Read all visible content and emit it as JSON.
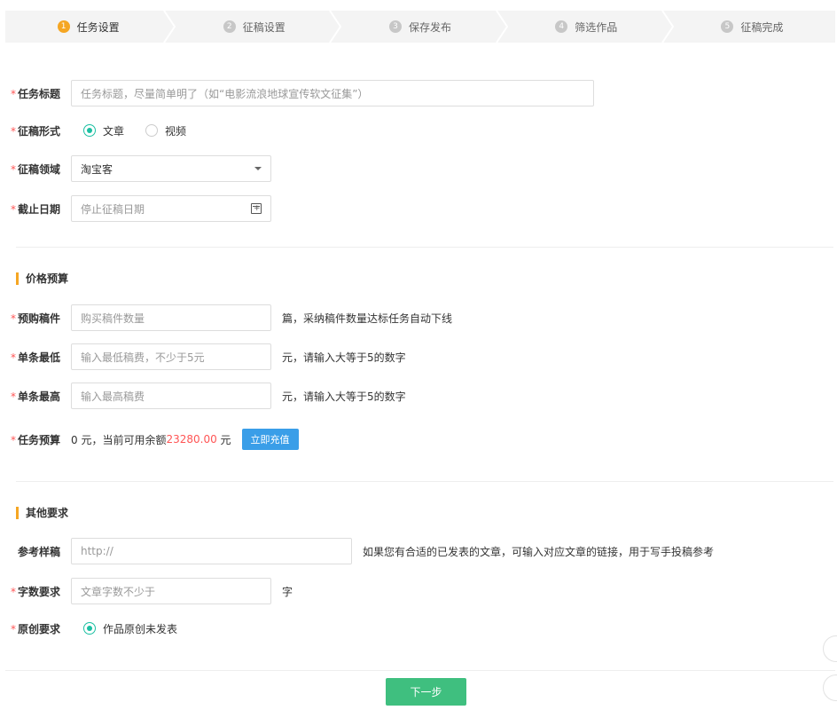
{
  "steps": [
    {
      "num": "1",
      "label": "任务设置"
    },
    {
      "num": "2",
      "label": "征稿设置"
    },
    {
      "num": "3",
      "label": "保存发布"
    },
    {
      "num": "4",
      "label": "筛选作品"
    },
    {
      "num": "5",
      "label": "征稿完成"
    }
  ],
  "form": {
    "task_title": {
      "label": "任务标题",
      "placeholder": "任务标题，尽量简单明了（如“电影流浪地球宣传软文征集”）"
    },
    "format": {
      "label": "征稿形式",
      "options": [
        "文章",
        "视频"
      ],
      "selected": "文章"
    },
    "domain": {
      "label": "征稿领域",
      "value": "淘宝客"
    },
    "deadline": {
      "label": "截止日期",
      "placeholder": "停止征稿日期"
    }
  },
  "budget": {
    "section_title": "价格预算",
    "purchase": {
      "label": "预购稿件",
      "placeholder": "购买稿件数量",
      "suffix": "篇，采纳稿件数量达标任务自动下线"
    },
    "min_price": {
      "label": "单条最低",
      "placeholder": "输入最低稿费，不少于5元",
      "suffix": "元，请输入大等于5的数字"
    },
    "max_price": {
      "label": "单条最高",
      "placeholder": "输入最高稿费",
      "suffix": "元，请输入大等于5的数字"
    },
    "total": {
      "label": "任务预算",
      "text_prefix": "0 元，当前可用余额 ",
      "balance": "23280.00",
      "text_suffix": " 元",
      "recharge_label": "立即充值"
    }
  },
  "other": {
    "section_title": "其他要求",
    "reference": {
      "label": "参考样稿",
      "placeholder": "http://",
      "suffix": "如果您有合适的已发表的文章，可输入对应文章的链接，用于写手投稿参考"
    },
    "word_count": {
      "label": "字数要求",
      "placeholder": "文章字数不少于",
      "suffix": "字"
    },
    "original": {
      "label": "原创要求",
      "option": "作品原创未发表"
    }
  },
  "next_button": "下一步",
  "colors": {
    "accent_orange": "#f5a623",
    "teal": "#1bbfa2",
    "blue": "#3a9ee8",
    "green": "#3fbf7f",
    "red": "#f55555"
  }
}
